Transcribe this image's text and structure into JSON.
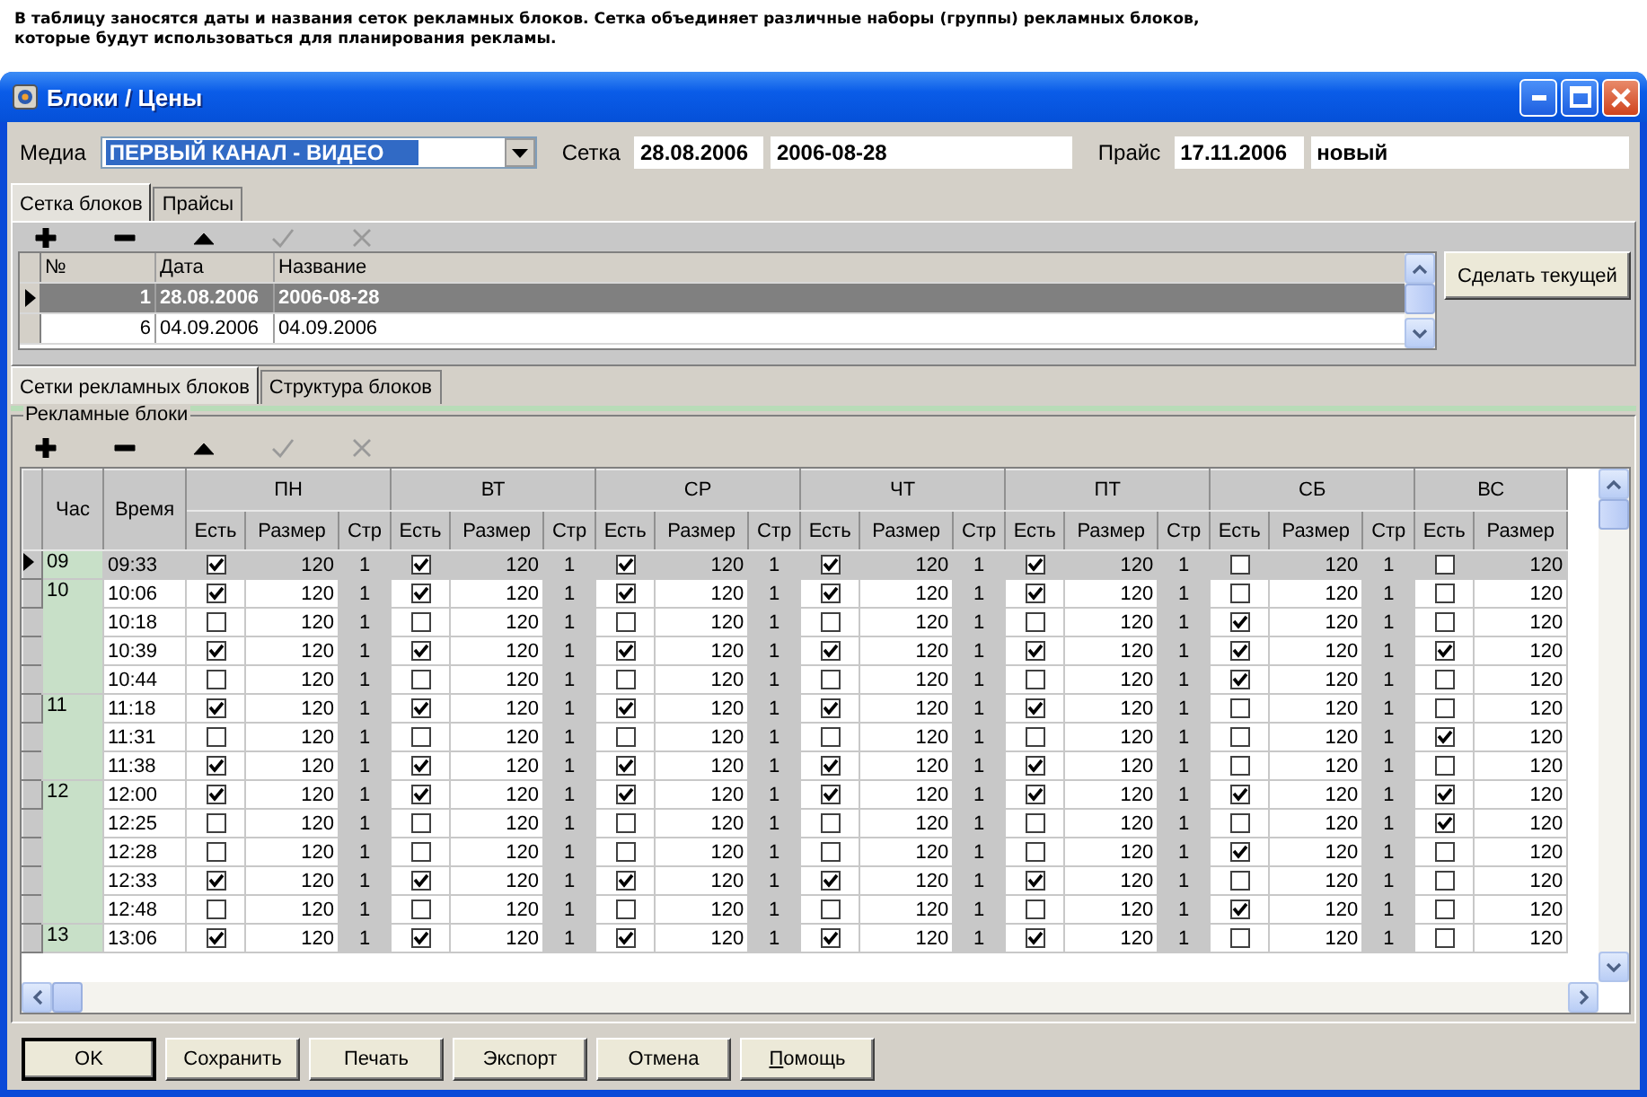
{
  "hint_lines": [
    "В таблицу заносятся даты и названия сеток рекламных блоков. Сетка объединяет различные наборы (группы) рекламных блоков,",
    "которые будут использоваться для планирования рекламы."
  ],
  "window": {
    "title": "Блоки / Цены"
  },
  "header": {
    "media_label": "Медиа",
    "media_value": "ПЕРВЫЙ КАНАЛ - ВИДЕО",
    "grid_label": "Сетка",
    "grid_date": "28.08.2006",
    "grid_name": "2006-08-28",
    "price_label": "Прайс",
    "price_date": "17.11.2006",
    "price_name": "новый"
  },
  "tabs": [
    {
      "label": "Сетка блоков",
      "selected": true
    },
    {
      "label": "Прайсы",
      "selected": false
    }
  ],
  "grid_toolbar": [
    {
      "kind": "add",
      "disabled": false
    },
    {
      "kind": "remove",
      "disabled": false
    },
    {
      "kind": "up",
      "disabled": false
    },
    {
      "kind": "confirm",
      "disabled": true
    },
    {
      "kind": "cancel",
      "disabled": true
    }
  ],
  "grids": {
    "columns": [
      "№",
      "Дата",
      "Название"
    ],
    "rows": [
      {
        "num": "1",
        "date": "28.08.2006",
        "name": "2006-08-28",
        "selected": true
      },
      {
        "num": "6",
        "date": "04.09.2006",
        "name": "04.09.2006",
        "selected": false
      }
    ]
  },
  "make_current_button": "Сделать текущей",
  "sub_tabs": [
    {
      "label": "Сетки рекламных блоков",
      "selected": true
    },
    {
      "label": "Структура блоков",
      "selected": false
    }
  ],
  "blocks": {
    "title": "Рекламные блоки",
    "toolbar": [
      {
        "kind": "add",
        "disabled": false
      },
      {
        "kind": "remove",
        "disabled": false
      },
      {
        "kind": "up",
        "disabled": false
      },
      {
        "kind": "confirm",
        "disabled": true
      },
      {
        "kind": "cancel",
        "disabled": true
      }
    ],
    "hour_header": "Час",
    "time_header": "Время",
    "days": [
      {
        "name": "ПН",
        "subcolumns": [
          "Есть",
          "Размер",
          "Стр"
        ]
      },
      {
        "name": "ВТ",
        "subcolumns": [
          "Есть",
          "Размер",
          "Стр"
        ]
      },
      {
        "name": "СР",
        "subcolumns": [
          "Есть",
          "Размер",
          "Стр"
        ]
      },
      {
        "name": "ЧТ",
        "subcolumns": [
          "Есть",
          "Размер",
          "Стр"
        ]
      },
      {
        "name": "ПТ",
        "subcolumns": [
          "Есть",
          "Размер",
          "Стр"
        ]
      },
      {
        "name": "СБ",
        "subcolumns": [
          "Есть",
          "Размер",
          "Стр"
        ]
      },
      {
        "name": "ВС",
        "subcolumns": [
          "Есть",
          "Размер"
        ]
      }
    ],
    "rows": [
      {
        "hour": "09",
        "time": "09:33",
        "selected": true,
        "cells": [
          {
            "has": true,
            "size": "120",
            "page": "1"
          },
          {
            "has": true,
            "size": "120",
            "page": "1"
          },
          {
            "has": true,
            "size": "120",
            "page": "1"
          },
          {
            "has": true,
            "size": "120",
            "page": "1"
          },
          {
            "has": true,
            "size": "120",
            "page": "1"
          },
          {
            "has": false,
            "size": "120",
            "page": "1"
          },
          {
            "has": false,
            "size": "120"
          }
        ]
      },
      {
        "hour": "10",
        "time": "10:06",
        "selected": false,
        "cells": [
          {
            "has": true,
            "size": "120",
            "page": "1"
          },
          {
            "has": true,
            "size": "120",
            "page": "1"
          },
          {
            "has": true,
            "size": "120",
            "page": "1"
          },
          {
            "has": true,
            "size": "120",
            "page": "1"
          },
          {
            "has": true,
            "size": "120",
            "page": "1"
          },
          {
            "has": false,
            "size": "120",
            "page": "1"
          },
          {
            "has": false,
            "size": "120"
          }
        ]
      },
      {
        "time": "10:18",
        "selected": false,
        "cells": [
          {
            "has": false,
            "size": "120",
            "page": "1"
          },
          {
            "has": false,
            "size": "120",
            "page": "1"
          },
          {
            "has": false,
            "size": "120",
            "page": "1"
          },
          {
            "has": false,
            "size": "120",
            "page": "1"
          },
          {
            "has": false,
            "size": "120",
            "page": "1"
          },
          {
            "has": true,
            "size": "120",
            "page": "1"
          },
          {
            "has": false,
            "size": "120"
          }
        ]
      },
      {
        "time": "10:39",
        "selected": false,
        "cells": [
          {
            "has": true,
            "size": "120",
            "page": "1"
          },
          {
            "has": true,
            "size": "120",
            "page": "1"
          },
          {
            "has": true,
            "size": "120",
            "page": "1"
          },
          {
            "has": true,
            "size": "120",
            "page": "1"
          },
          {
            "has": true,
            "size": "120",
            "page": "1"
          },
          {
            "has": true,
            "size": "120",
            "page": "1"
          },
          {
            "has": true,
            "size": "120"
          }
        ]
      },
      {
        "time": "10:44",
        "selected": false,
        "cells": [
          {
            "has": false,
            "size": "120",
            "page": "1"
          },
          {
            "has": false,
            "size": "120",
            "page": "1"
          },
          {
            "has": false,
            "size": "120",
            "page": "1"
          },
          {
            "has": false,
            "size": "120",
            "page": "1"
          },
          {
            "has": false,
            "size": "120",
            "page": "1"
          },
          {
            "has": true,
            "size": "120",
            "page": "1"
          },
          {
            "has": false,
            "size": "120"
          }
        ]
      },
      {
        "hour": "11",
        "time": "11:18",
        "selected": false,
        "cells": [
          {
            "has": true,
            "size": "120",
            "page": "1"
          },
          {
            "has": true,
            "size": "120",
            "page": "1"
          },
          {
            "has": true,
            "size": "120",
            "page": "1"
          },
          {
            "has": true,
            "size": "120",
            "page": "1"
          },
          {
            "has": true,
            "size": "120",
            "page": "1"
          },
          {
            "has": false,
            "size": "120",
            "page": "1"
          },
          {
            "has": false,
            "size": "120"
          }
        ]
      },
      {
        "time": "11:31",
        "selected": false,
        "cells": [
          {
            "has": false,
            "size": "120",
            "page": "1"
          },
          {
            "has": false,
            "size": "120",
            "page": "1"
          },
          {
            "has": false,
            "size": "120",
            "page": "1"
          },
          {
            "has": false,
            "size": "120",
            "page": "1"
          },
          {
            "has": false,
            "size": "120",
            "page": "1"
          },
          {
            "has": false,
            "size": "120",
            "page": "1"
          },
          {
            "has": true,
            "size": "120"
          }
        ]
      },
      {
        "time": "11:38",
        "selected": false,
        "cells": [
          {
            "has": true,
            "size": "120",
            "page": "1"
          },
          {
            "has": true,
            "size": "120",
            "page": "1"
          },
          {
            "has": true,
            "size": "120",
            "page": "1"
          },
          {
            "has": true,
            "size": "120",
            "page": "1"
          },
          {
            "has": true,
            "size": "120",
            "page": "1"
          },
          {
            "has": false,
            "size": "120",
            "page": "1"
          },
          {
            "has": false,
            "size": "120"
          }
        ]
      },
      {
        "hour": "12",
        "time": "12:00",
        "selected": false,
        "cells": [
          {
            "has": true,
            "size": "120",
            "page": "1"
          },
          {
            "has": true,
            "size": "120",
            "page": "1"
          },
          {
            "has": true,
            "size": "120",
            "page": "1"
          },
          {
            "has": true,
            "size": "120",
            "page": "1"
          },
          {
            "has": true,
            "size": "120",
            "page": "1"
          },
          {
            "has": true,
            "size": "120",
            "page": "1"
          },
          {
            "has": true,
            "size": "120"
          }
        ]
      },
      {
        "time": "12:25",
        "selected": false,
        "cells": [
          {
            "has": false,
            "size": "120",
            "page": "1"
          },
          {
            "has": false,
            "size": "120",
            "page": "1"
          },
          {
            "has": false,
            "size": "120",
            "page": "1"
          },
          {
            "has": false,
            "size": "120",
            "page": "1"
          },
          {
            "has": false,
            "size": "120",
            "page": "1"
          },
          {
            "has": false,
            "size": "120",
            "page": "1"
          },
          {
            "has": true,
            "size": "120"
          }
        ]
      },
      {
        "time": "12:28",
        "selected": false,
        "cells": [
          {
            "has": false,
            "size": "120",
            "page": "1"
          },
          {
            "has": false,
            "size": "120",
            "page": "1"
          },
          {
            "has": false,
            "size": "120",
            "page": "1"
          },
          {
            "has": false,
            "size": "120",
            "page": "1"
          },
          {
            "has": false,
            "size": "120",
            "page": "1"
          },
          {
            "has": true,
            "size": "120",
            "page": "1"
          },
          {
            "has": false,
            "size": "120"
          }
        ]
      },
      {
        "time": "12:33",
        "selected": false,
        "cells": [
          {
            "has": true,
            "size": "120",
            "page": "1"
          },
          {
            "has": true,
            "size": "120",
            "page": "1"
          },
          {
            "has": true,
            "size": "120",
            "page": "1"
          },
          {
            "has": true,
            "size": "120",
            "page": "1"
          },
          {
            "has": true,
            "size": "120",
            "page": "1"
          },
          {
            "has": false,
            "size": "120",
            "page": "1"
          },
          {
            "has": false,
            "size": "120"
          }
        ]
      },
      {
        "time": "12:48",
        "selected": false,
        "cells": [
          {
            "has": false,
            "size": "120",
            "page": "1"
          },
          {
            "has": false,
            "size": "120",
            "page": "1"
          },
          {
            "has": false,
            "size": "120",
            "page": "1"
          },
          {
            "has": false,
            "size": "120",
            "page": "1"
          },
          {
            "has": false,
            "size": "120",
            "page": "1"
          },
          {
            "has": true,
            "size": "120",
            "page": "1"
          },
          {
            "has": false,
            "size": "120"
          }
        ]
      },
      {
        "hour": "13",
        "time": "13:06",
        "selected": false,
        "cells": [
          {
            "has": true,
            "size": "120",
            "page": "1"
          },
          {
            "has": true,
            "size": "120",
            "page": "1"
          },
          {
            "has": true,
            "size": "120",
            "page": "1"
          },
          {
            "has": true,
            "size": "120",
            "page": "1"
          },
          {
            "has": true,
            "size": "120",
            "page": "1"
          },
          {
            "has": false,
            "size": "120",
            "page": "1"
          },
          {
            "has": false,
            "size": "120"
          }
        ]
      }
    ]
  },
  "buttons": [
    {
      "label": "OK",
      "default": true,
      "accelerator": false
    },
    {
      "label": "Сохранить",
      "default": false,
      "accelerator": false
    },
    {
      "label": "Печать",
      "default": false,
      "accelerator": false
    },
    {
      "label": "Экспорт",
      "default": false,
      "accelerator": false
    },
    {
      "label": "Отмена",
      "default": false,
      "accelerator": false
    },
    {
      "label": "Помощь",
      "default": false,
      "accelerator": true
    }
  ]
}
